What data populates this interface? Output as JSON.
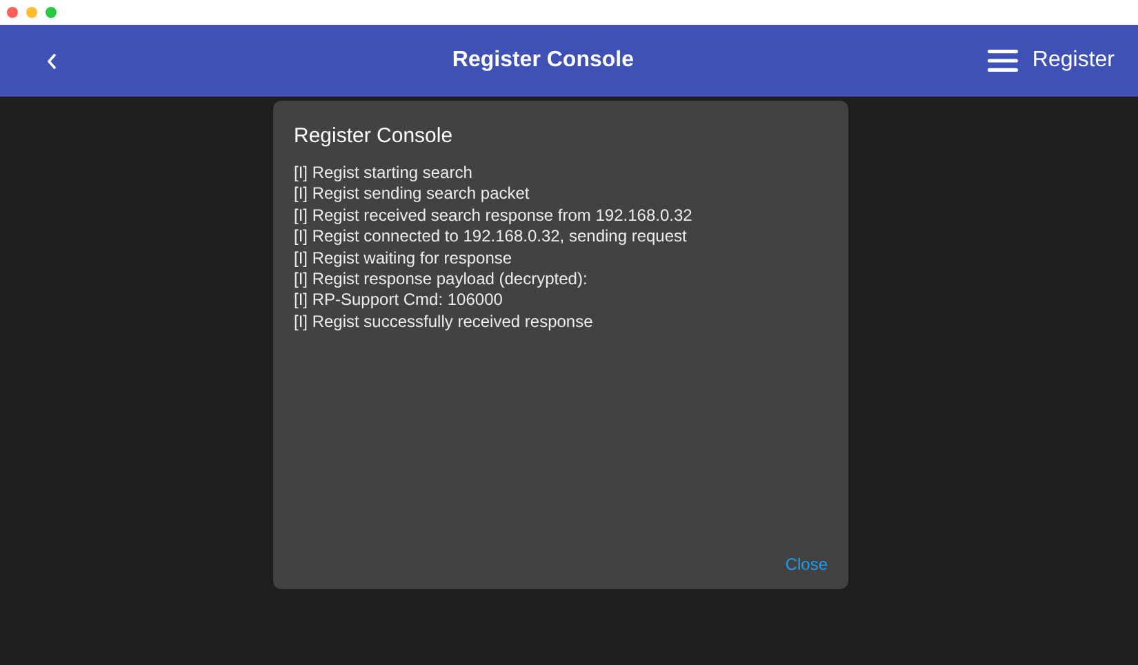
{
  "app_bar": {
    "title": "Register Console",
    "menu_label": "Register"
  },
  "dialog": {
    "title": "Register Console",
    "log_lines": [
      "[I] Regist starting search",
      "[I] Regist sending search packet",
      "[I] Regist received search response from 192.168.0.32",
      "[I] Regist connected to 192.168.0.32, sending request",
      "[I] Regist waiting for response",
      "[I] Regist response payload (decrypted):",
      "[I] RP-Support Cmd: 106000",
      "[I] Regist successfully received response"
    ],
    "close_button": "Close"
  }
}
